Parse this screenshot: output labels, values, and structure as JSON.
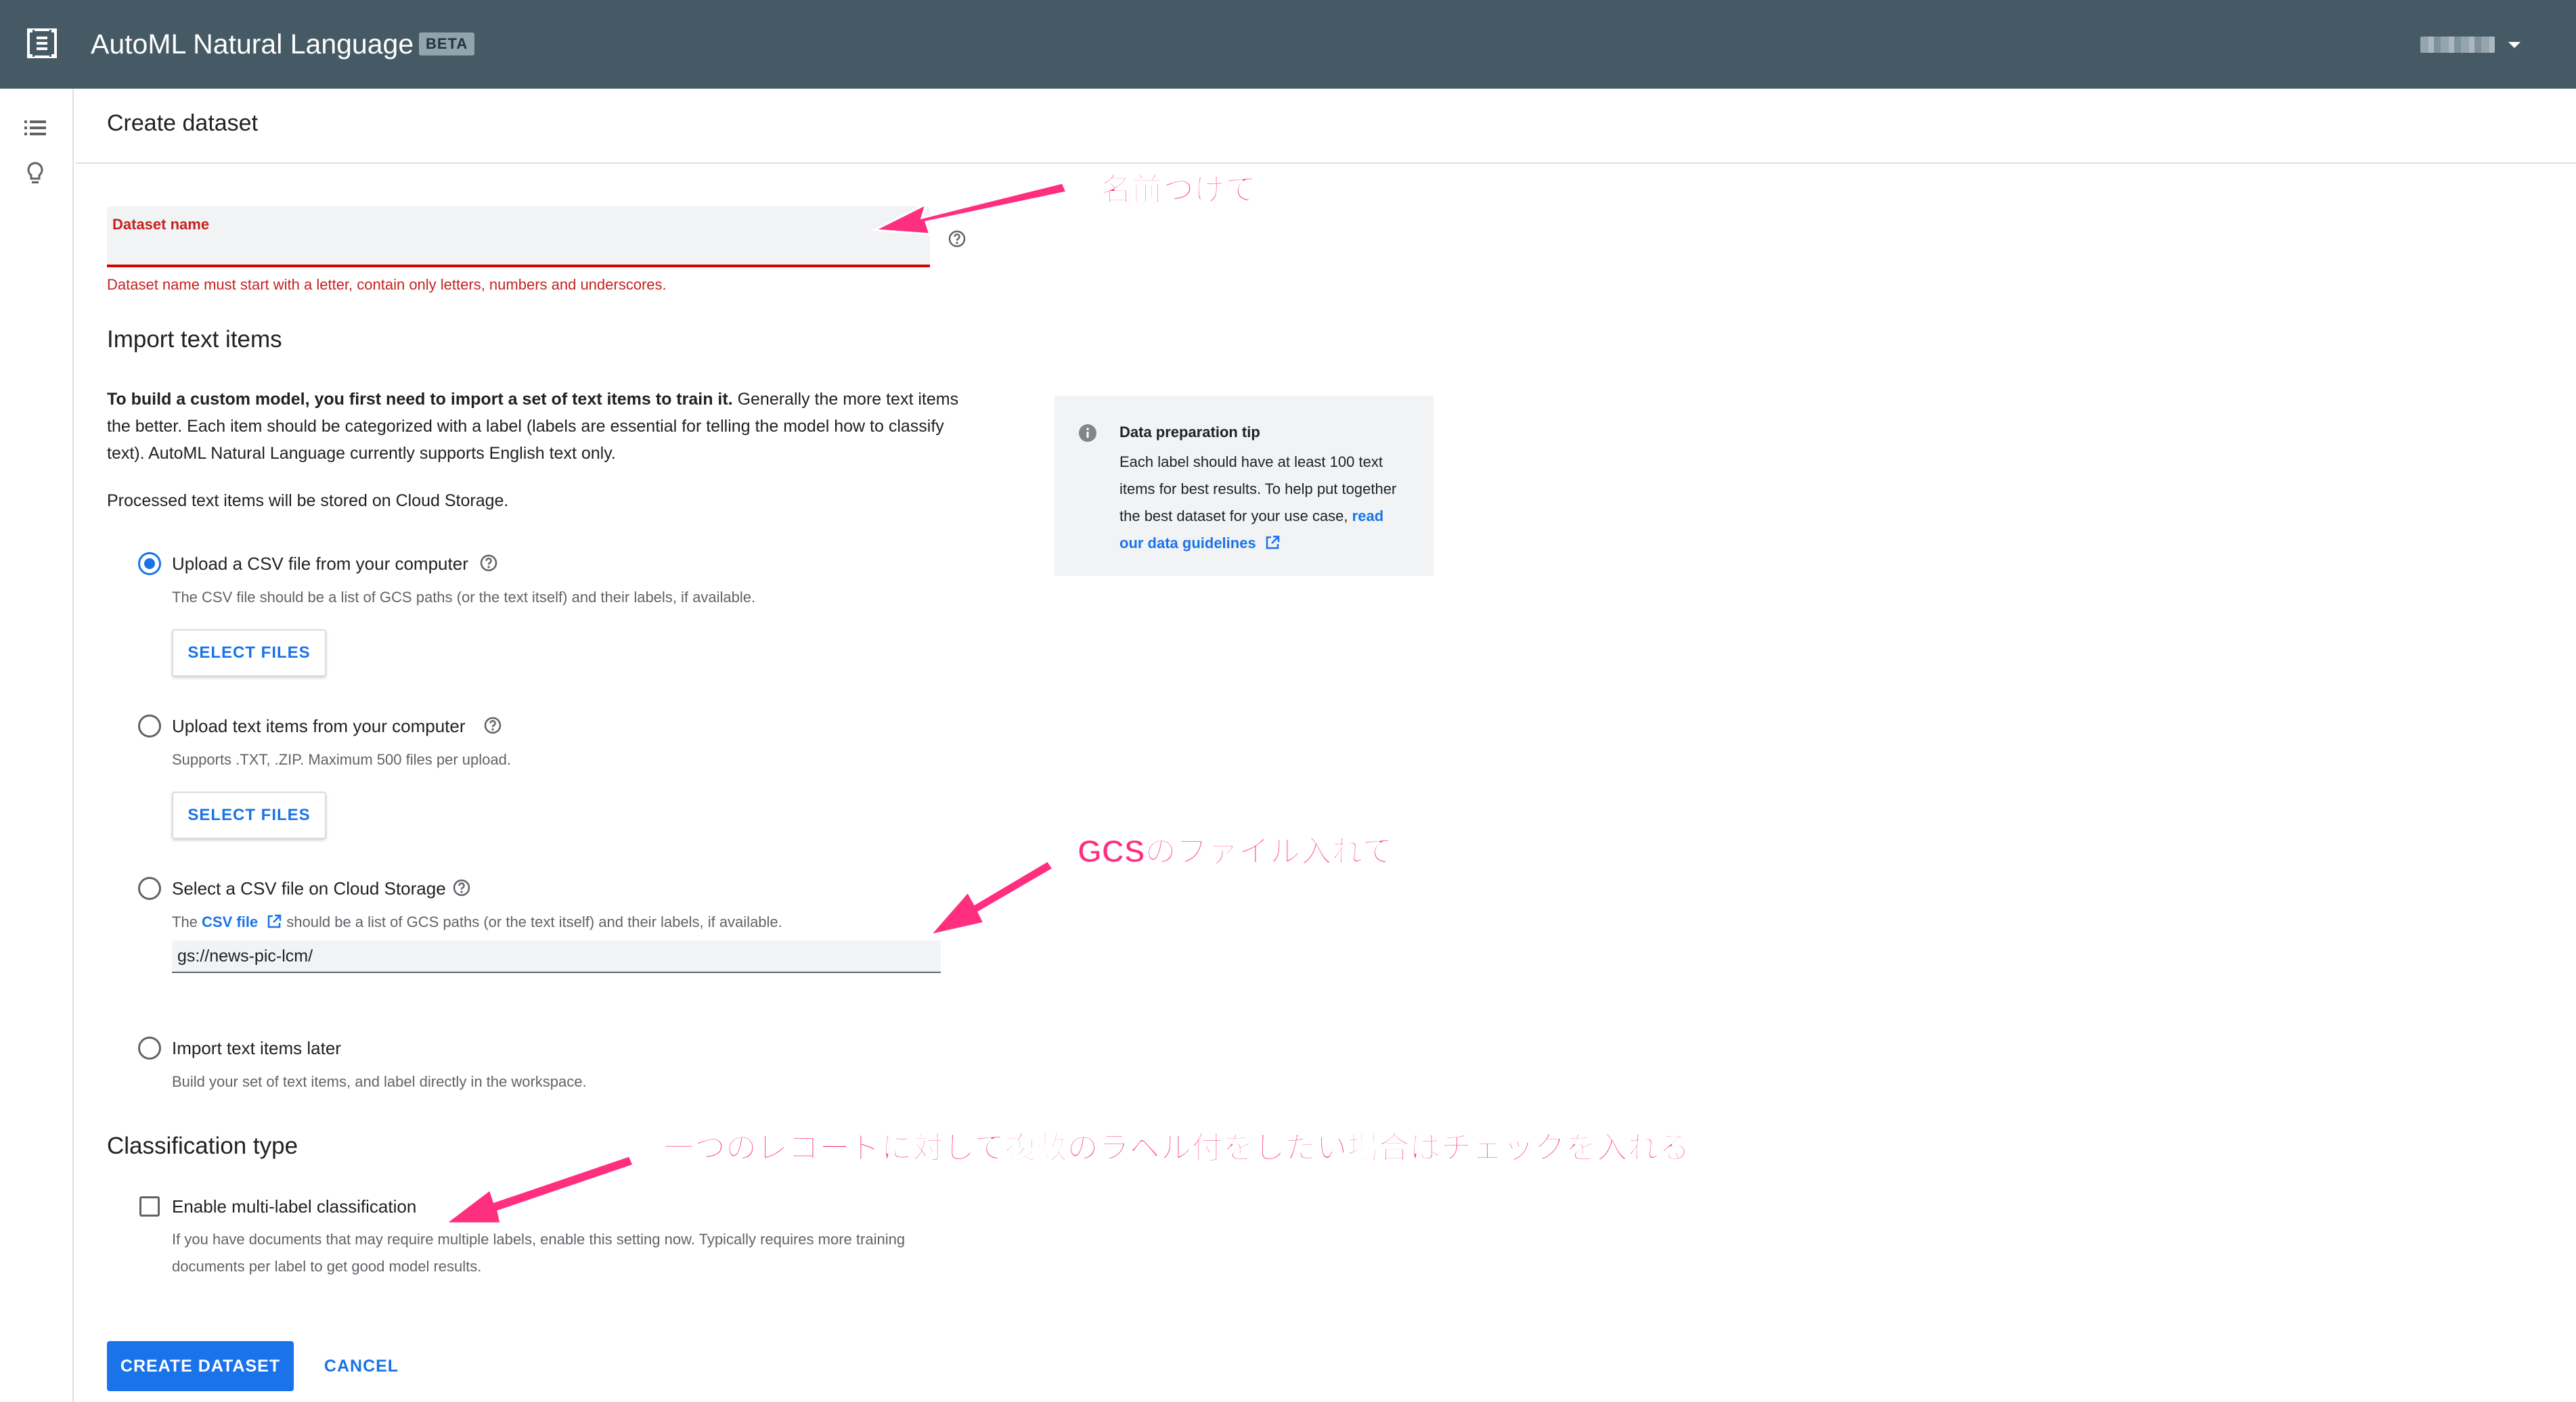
{
  "topbar": {
    "app_title": "AutoML Natural Language",
    "badge": "BETA",
    "color": "#455a64"
  },
  "leftrail": {
    "icons": [
      "list-icon",
      "lightbulb-icon"
    ]
  },
  "header": {
    "page_title": "Create dataset"
  },
  "dataset_name": {
    "label": "Dataset name",
    "value": "",
    "error": "Dataset name must start with a letter, contain only letters, numbers and underscores."
  },
  "import_section": {
    "title": "Import text items",
    "intro_bold": "To build a custom model, you first need to import a set of text items to train it.",
    "intro_rest": " Generally the more text items the better. Each item should be categorized with a label (labels are essential for telling the model how to classify text). AutoML Natural Language currently supports English text only.",
    "storage_note": "Processed text items will be stored on Cloud Storage."
  },
  "tip": {
    "title": "Data preparation tip",
    "body": "Each label should have at least 100 text items for best results. To help put together the best dataset for your use case, ",
    "link": "read our data guidelines"
  },
  "options": [
    {
      "label": "Upload a CSV file from your computer",
      "desc": "The CSV file should be a list of GCS paths (or the text itself) and their labels, if available.",
      "button": "SELECT FILES",
      "selected": true
    },
    {
      "label": "Upload text items from your computer",
      "desc": "Supports .TXT, .ZIP. Maximum 500 files per upload.",
      "button": "SELECT FILES",
      "selected": false
    },
    {
      "label": "Select a CSV file on Cloud Storage",
      "desc_prefix": "The ",
      "desc_link": "CSV file",
      "desc_suffix": " should be a list of GCS paths (or the text itself) and their labels, if available.",
      "input_value": "gs://news-pic-lcm/",
      "selected": false
    },
    {
      "label": "Import text items later",
      "desc": "Build your set of text items, and label directly in the workspace.",
      "selected": false
    }
  ],
  "classification": {
    "title": "Classification type",
    "checkbox_label": "Enable multi-label classification",
    "checked": false,
    "desc": "If you have documents that may require multiple labels, enable this setting now. Typically requires more training documents per label to get good model results."
  },
  "actions": {
    "create": "CREATE DATASET",
    "cancel": "CANCEL"
  },
  "annotations": {
    "name_note": "名前つけて",
    "gcs_note": "GCSのファイル入れて",
    "multilabel_note": "一つのレコードに対して複数のラベル付をしたい場合はチェックを入れる",
    "color": "#ff2e7e"
  }
}
